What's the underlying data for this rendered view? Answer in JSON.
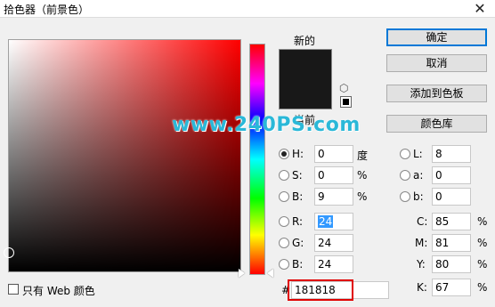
{
  "window": {
    "title": "拾色器（前景色）",
    "close_glyph": "✕"
  },
  "preview": {
    "new_label": "新的",
    "current_label": "当前",
    "new_color": "#181818"
  },
  "watermark": "www.240PS.com",
  "buttons": {
    "ok": "确定",
    "cancel": "取消",
    "add_to_swatches": "添加到色板",
    "color_libraries": "颜色库"
  },
  "hsb": {
    "h": {
      "label": "H:",
      "value": "0",
      "unit": "度",
      "checked": true
    },
    "s": {
      "label": "S:",
      "value": "0",
      "unit": "%"
    },
    "b": {
      "label": "B:",
      "value": "9",
      "unit": "%"
    }
  },
  "rgb": {
    "r": {
      "label": "R:",
      "value": "24"
    },
    "g": {
      "label": "G:",
      "value": "24"
    },
    "b": {
      "label": "B:",
      "value": "24"
    }
  },
  "lab": {
    "l": {
      "label": "L:",
      "value": "8"
    },
    "a": {
      "label": "a:",
      "value": "0"
    },
    "b": {
      "label": "b:",
      "value": "0"
    }
  },
  "cmyk": {
    "c": {
      "label": "C:",
      "value": "85",
      "unit": "%"
    },
    "m": {
      "label": "M:",
      "value": "81",
      "unit": "%"
    },
    "y": {
      "label": "Y:",
      "value": "80",
      "unit": "%"
    },
    "k": {
      "label": "K:",
      "value": "67",
      "unit": "%"
    }
  },
  "hex": {
    "label": "#",
    "value": "181818"
  },
  "web_only": {
    "label": "只有 Web 颜色",
    "checked": false
  },
  "colors": {
    "accent": "#0078d7",
    "highlight_box": "#e00000",
    "watermark": "#2ab8d8"
  },
  "icons": {
    "cube": "out-of-gamut-cube-icon",
    "websafe": "websafe-swatch-icon"
  }
}
